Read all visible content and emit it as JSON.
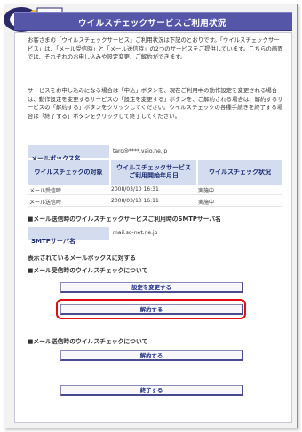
{
  "header": {
    "title": "ウイルスチェックサービスご利用状況",
    "logo_text": "So-net"
  },
  "intro": {
    "paragraph1": "お客さまの「ウイルスチェックサービス」ご利用状況は下記のとおりです。「ウイルスチェックサービス」は、「メール受信時」と「メール送信時」の2つのサービスをご提供しています。こちらの画面では、それぞれのお申し込みや設定変更、ご解約ができます。",
    "paragraph2": "サービスをお申し込みになる場合は「申込」ボタンを、現在ご利用中の動作設定を変更される場合は、動作設定を変更するサービスの「設定を変更する」ボタンを、ご解約される場合は、解約するサービスの「解約する」ボタンをクリックしてください。ウイルスチェックの各種手続きを終了する場合は「終了する」ボタンをクリックして終了してください。"
  },
  "mailbox": {
    "label": "メールボックス名",
    "value": "taro@****.vaio.ne.jp"
  },
  "status_table": {
    "headers": [
      "ウイルスチェックの対象",
      "ウイルスチェックサービス\nご利用開始年月日",
      "ウイルスチェック状況"
    ],
    "rows": [
      [
        "メール受信時",
        "2008/03/10 16:31",
        "実施中"
      ],
      [
        "メール送信時",
        "2008/03/10 16:11",
        "実施中"
      ]
    ]
  },
  "smtp": {
    "heading": "■メール送信時のウイルスチェックサービスご利用時のSMTPサーバ名",
    "label": "SMTPサーバ名",
    "value": "mail.so-net.ne.jp"
  },
  "sections": {
    "displayed_for": "表示されているメールボックスに対する",
    "incoming_title": "■メール受信時のウイルスチェックについて",
    "outgoing_title": "■メール送信時のウイルスチェックについて"
  },
  "buttons": {
    "change_settings": "設定を変更する",
    "cancel_incoming": "解約する",
    "cancel_outgoing": "解約する",
    "finish": "終了する"
  },
  "colors": {
    "header_bar": "#5656a8",
    "label_bg": "#d4ddf0",
    "highlight": "#e01010"
  }
}
